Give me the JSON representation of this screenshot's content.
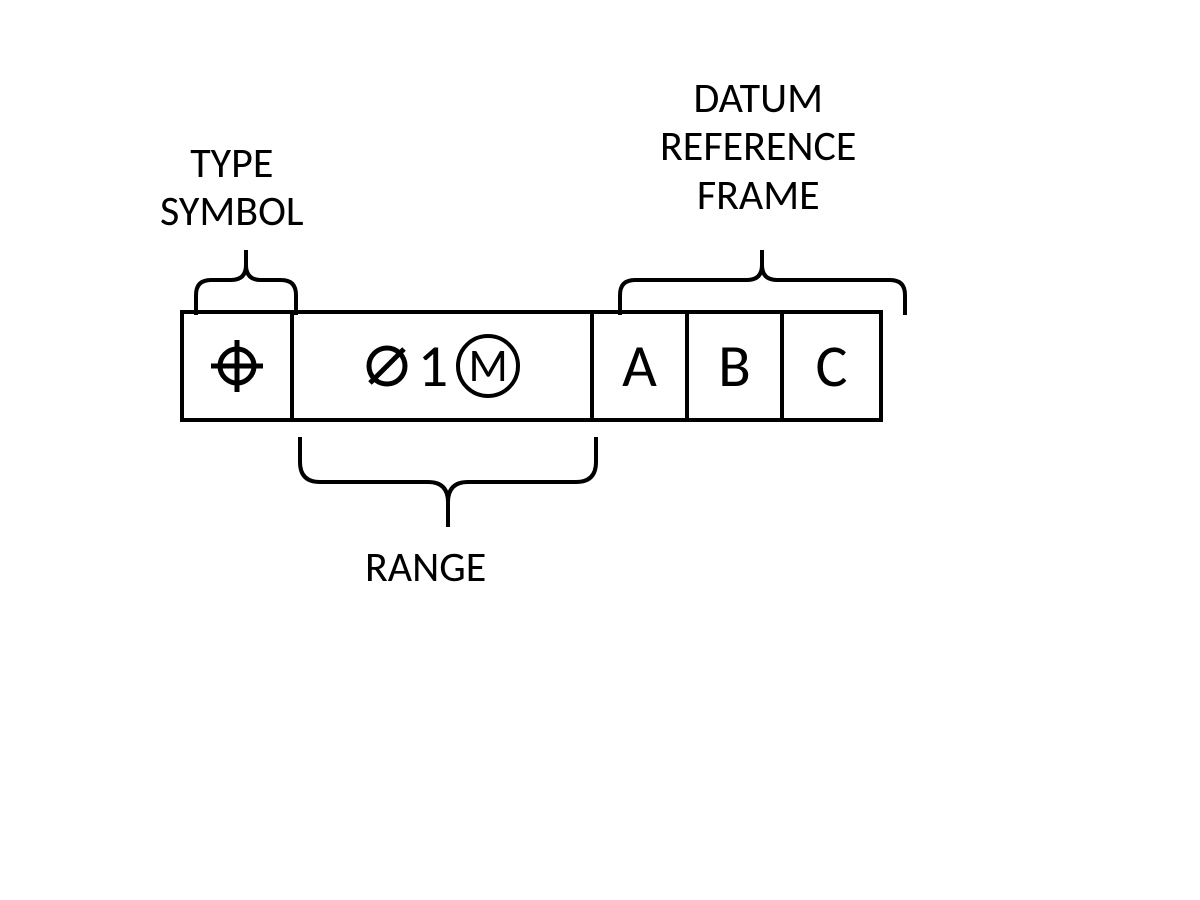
{
  "labels": {
    "type_symbol_line1": "TYPE",
    "type_symbol_line2": "SYMBOL",
    "datum_line1": "DATUM",
    "datum_line2": "REFERENCE",
    "datum_line3": "FRAME",
    "range": "RANGE"
  },
  "fcf": {
    "type_symbol": "position",
    "range": {
      "diameter": true,
      "value": "1",
      "modifier": "M"
    },
    "datums": [
      "A",
      "B",
      "C"
    ]
  }
}
